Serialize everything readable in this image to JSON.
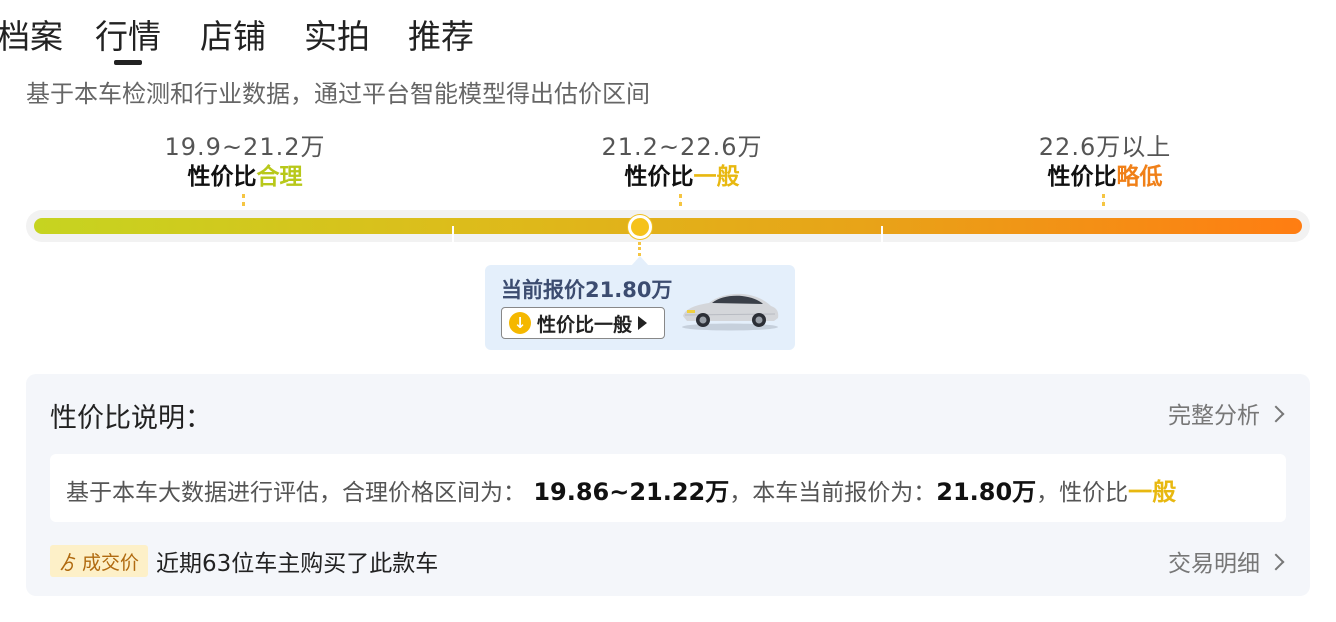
{
  "tabs": [
    {
      "label": "档案"
    },
    {
      "label": "行情"
    },
    {
      "label": "店铺"
    },
    {
      "label": "实拍"
    },
    {
      "label": "推荐"
    }
  ],
  "active_tab": "行情",
  "subtitle": "基于本车检测和行业数据，通过平台智能模型得出估价区间",
  "ranges": [
    {
      "value": "19.9~21.2万",
      "prefix": "性价比",
      "level": "合理",
      "color": "#b8c81a"
    },
    {
      "value": "21.2~22.6万",
      "prefix": "性价比",
      "level": "一般",
      "color": "#e8b810"
    },
    {
      "value": "22.6万以上",
      "prefix": "性价比",
      "level": "略低",
      "color": "#f08018"
    }
  ],
  "popup": {
    "current_price": "当前报价21.80万",
    "chip_label": "性价比一般"
  },
  "panel": {
    "title": "性价比说明：",
    "full_analysis": "完整分析",
    "desc_prefix": "基于本车大数据进行评估，合理价格区间为：",
    "fair_range": "19.86~21.22万",
    "desc_mid": "，本车当前报价为：",
    "current_price": "21.80万",
    "desc_suffix": "，性价比",
    "verdict": "一般",
    "verdict_color": "#e8b810",
    "badge": "成交价",
    "deal_text": "近期63位车主购买了此款车",
    "deal_detail": "交易明细"
  }
}
